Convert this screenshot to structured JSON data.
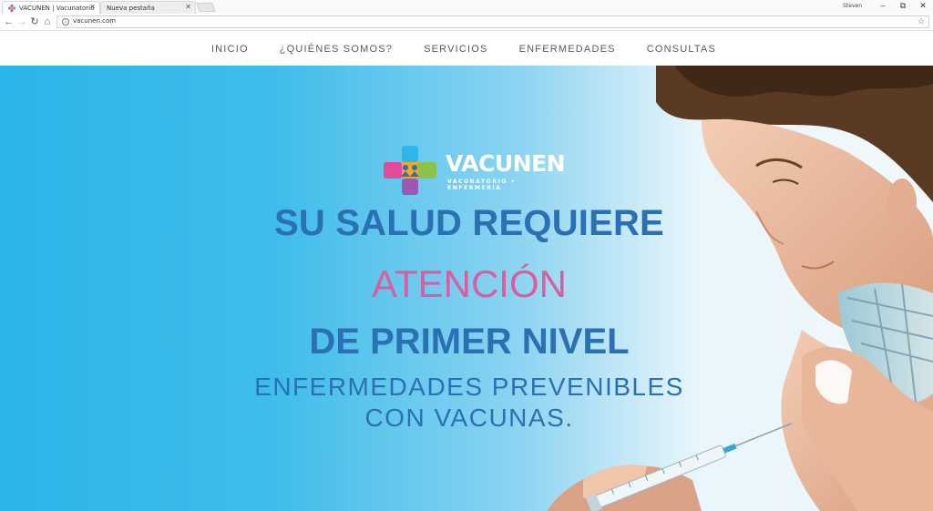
{
  "browser": {
    "tabs": [
      {
        "title": "VACUNEN | Vacunatorio"
      },
      {
        "title": "Nueva pestaña"
      }
    ],
    "user": "Steven",
    "url": "vacunen.com"
  },
  "nav": {
    "items": [
      "INICIO",
      "¿QUIÉNES SOMOS?",
      "SERVICIOS",
      "ENFERMEDADES",
      "CONSULTAS"
    ]
  },
  "hero": {
    "logo_name": "VACUNEN",
    "logo_tagline": "VACUNATORIO • ENFERMERÍA",
    "line1": "SU SALUD REQUIERE",
    "line2": "ATENCIÓN",
    "line3": "DE PRIMER NIVEL",
    "sub1": "ENFERMEDADES PREVENIBLES",
    "sub2": "CON VACUNAS."
  },
  "colors": {
    "headline_blue": "#2a70b3",
    "accent_pink": "#d95ea0",
    "hero_bg": "#2ab5e8"
  }
}
